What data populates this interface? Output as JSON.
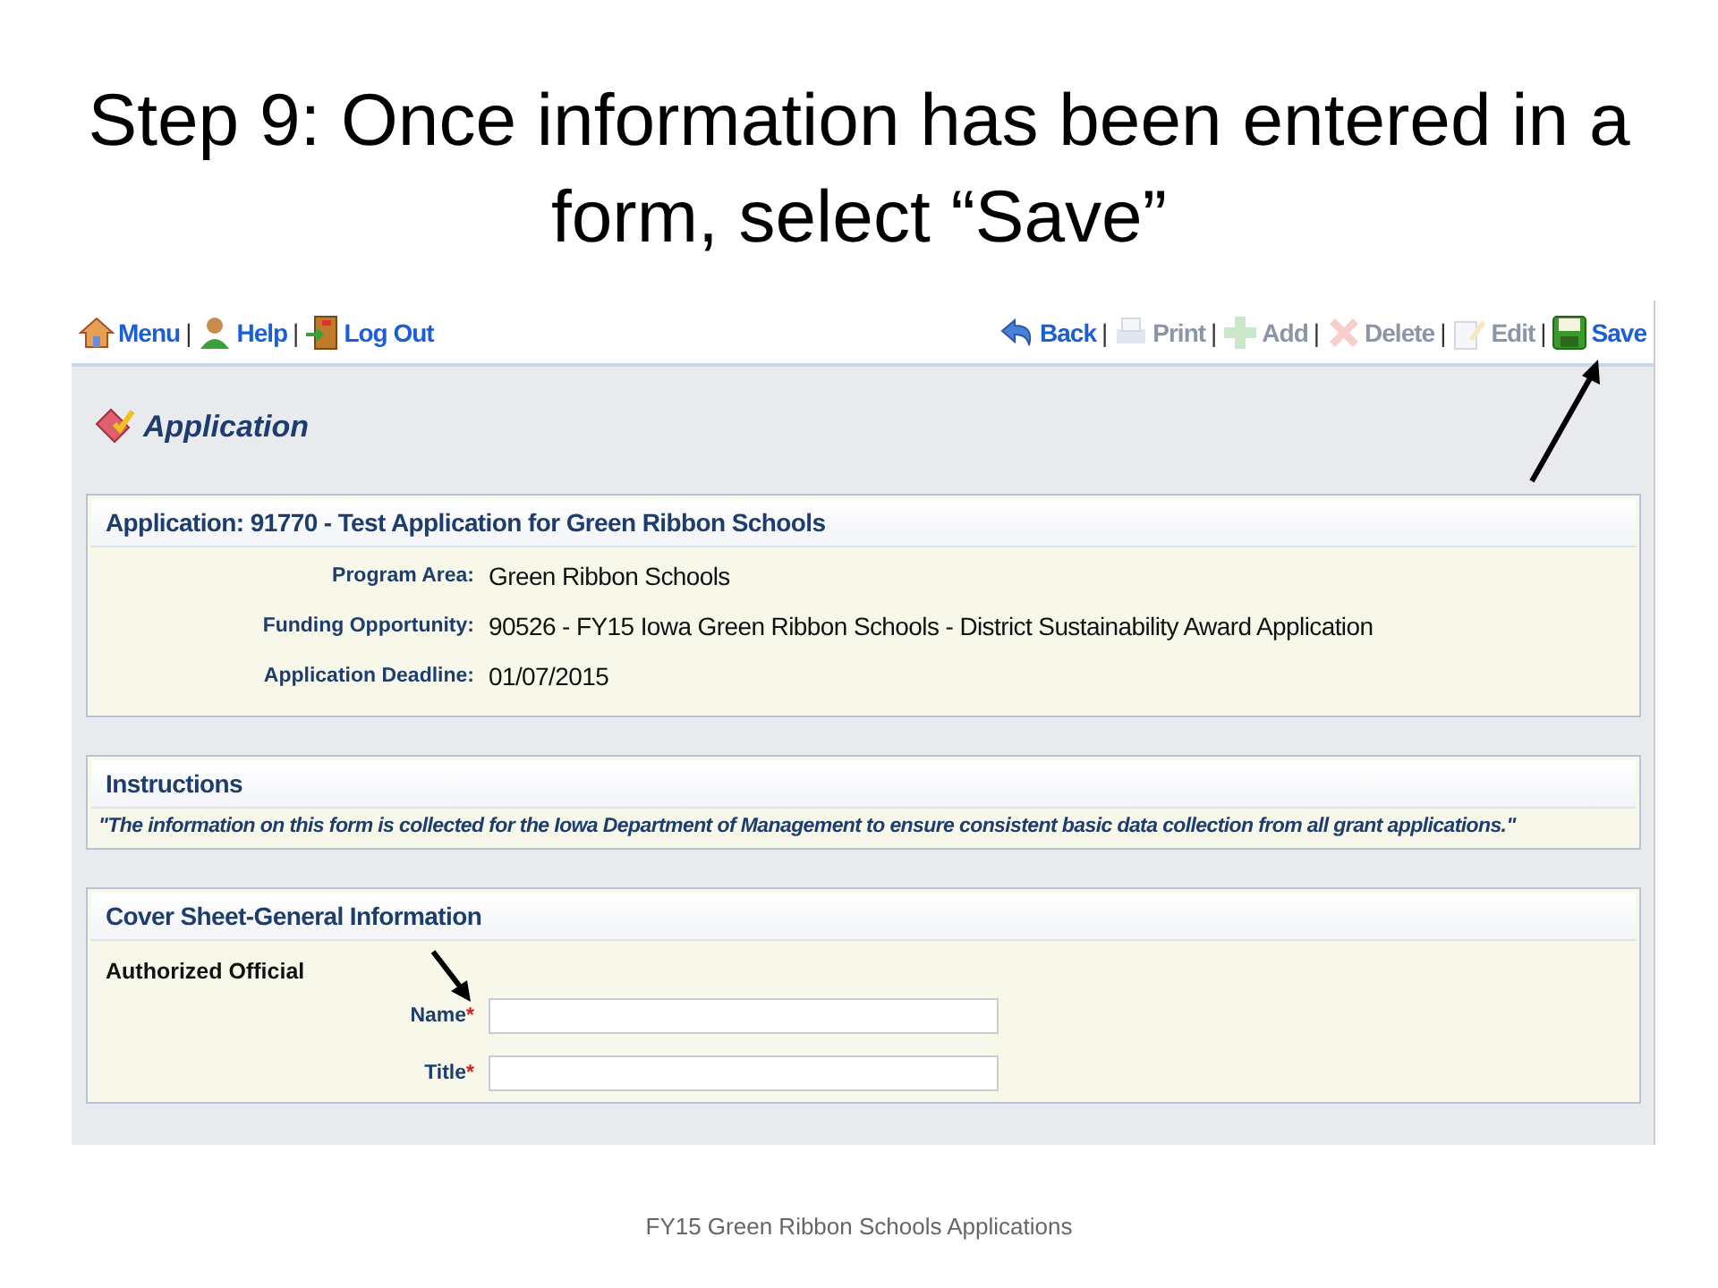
{
  "slide_title": "Step 9: Once information has been entered in a form, select “Save”",
  "toolbar_left": [
    {
      "label": "Menu",
      "disabled": false
    },
    {
      "label": "Help",
      "disabled": false
    },
    {
      "label": "Log Out",
      "disabled": false
    }
  ],
  "toolbar_right": [
    {
      "label": "Back",
      "disabled": false
    },
    {
      "label": "Print",
      "disabled": true
    },
    {
      "label": "Add",
      "disabled": true
    },
    {
      "label": "Delete",
      "disabled": true
    },
    {
      "label": "Edit",
      "disabled": true
    },
    {
      "label": "Save",
      "disabled": false
    }
  ],
  "separator": "|",
  "page_heading": "Application",
  "application_panel": {
    "title": "Application: 91770 - Test Application for Green Ribbon Schools",
    "fields": [
      {
        "label": "Program Area:",
        "value": "Green Ribbon Schools"
      },
      {
        "label": "Funding Opportunity:",
        "value": "90526 - FY15 Iowa Green Ribbon Schools - District Sustainability Award Application"
      },
      {
        "label": "Application Deadline:",
        "value": "01/07/2015"
      }
    ]
  },
  "instructions_panel": {
    "title": "Instructions",
    "text": "\"The information on this form is collected for the Iowa Department of Management to ensure consistent basic data collection from all grant applications.\""
  },
  "cover_panel": {
    "title": "Cover Sheet-General Information",
    "section": "Authorized Official",
    "inputs": [
      {
        "label": "Name",
        "required": true,
        "required_mark": "*"
      },
      {
        "label": "Title",
        "required": true,
        "required_mark": "*"
      }
    ]
  },
  "footer": "FY15 Green Ribbon Schools Applications"
}
